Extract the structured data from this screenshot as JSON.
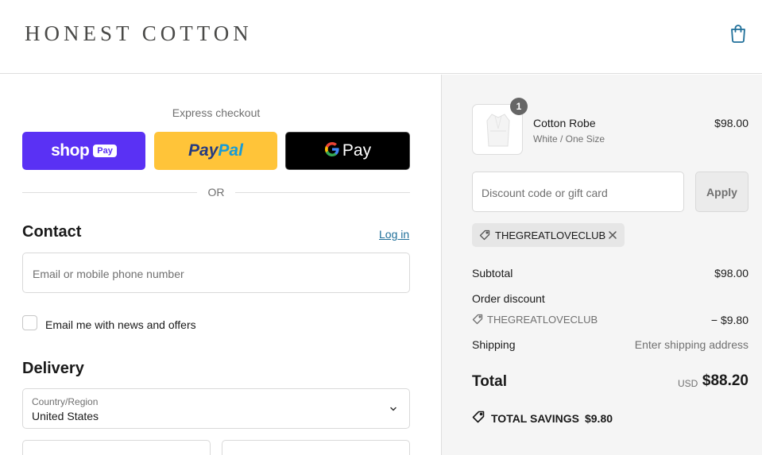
{
  "header": {
    "brand": "HONEST COTTON",
    "cart_icon": "shopping-bag-icon",
    "accent_color": "#1f6f99"
  },
  "express": {
    "label": "Express checkout",
    "shop_pay": {
      "word": "shop",
      "pill": "Pay",
      "color": "#5a31f4"
    },
    "paypal": {
      "part1": "Pay",
      "part2": "Pal",
      "color": "#ffc439"
    },
    "gpay": {
      "letter": "G",
      "word": "Pay",
      "color": "#000000"
    },
    "or_text": "OR"
  },
  "contact": {
    "title": "Contact",
    "login_link": "Log in",
    "email_placeholder": "Email or mobile phone number",
    "newsletter_label": "Email me with news and offers"
  },
  "delivery": {
    "title": "Delivery",
    "country_label": "Country/Region",
    "country_value": "United States"
  },
  "order": {
    "item": {
      "name": "Cotton Robe",
      "variant": "White / One Size",
      "price": "$98.00",
      "quantity": "1"
    },
    "discount_placeholder": "Discount code or gift card",
    "apply_label": "Apply",
    "applied_code": "THEGREATLOVECLUB",
    "subtotal_label": "Subtotal",
    "subtotal_value": "$98.00",
    "order_discount_label": "Order discount",
    "order_discount_code": "THEGREATLOVECLUB",
    "order_discount_value": "− $9.80",
    "shipping_label": "Shipping",
    "shipping_value": "Enter shipping address",
    "total_label": "Total",
    "total_currency": "USD",
    "total_value": "$88.20",
    "savings_label": "TOTAL SAVINGS",
    "savings_value": "$9.80"
  }
}
